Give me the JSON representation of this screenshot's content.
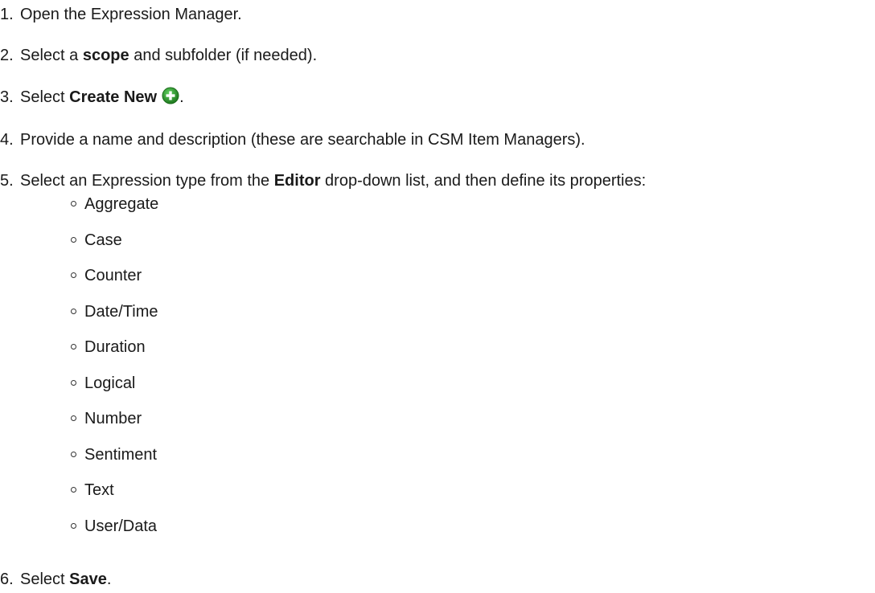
{
  "steps": [
    {
      "num": "1.",
      "pre": "Open the Expression Manager.",
      "bold": "",
      "post": ""
    },
    {
      "num": "2.",
      "pre": "Select a ",
      "bold": "scope",
      "post": " and subfolder (if needed)."
    },
    {
      "num": "3.",
      "pre": "Select ",
      "bold": "Create New",
      "post": "."
    },
    {
      "num": "4.",
      "pre": "Provide a name and description (these are searchable in CSM Item Managers).",
      "bold": "",
      "post": ""
    },
    {
      "num": "5.",
      "pre": "Select an Expression type from the ",
      "bold": "Editor",
      "post": " drop-down list, and then define its properties:"
    },
    {
      "num": "6.",
      "pre": "Select ",
      "bold": "Save",
      "post": "."
    }
  ],
  "expression_types": [
    "Aggregate",
    "Case",
    "Counter",
    "Date/Time",
    "Duration",
    "Logical",
    "Number",
    "Sentiment",
    "Text",
    "User/Data"
  ],
  "icons": {
    "create_new": "plus-circle-icon",
    "create_new_color": "#2e8b2e"
  }
}
